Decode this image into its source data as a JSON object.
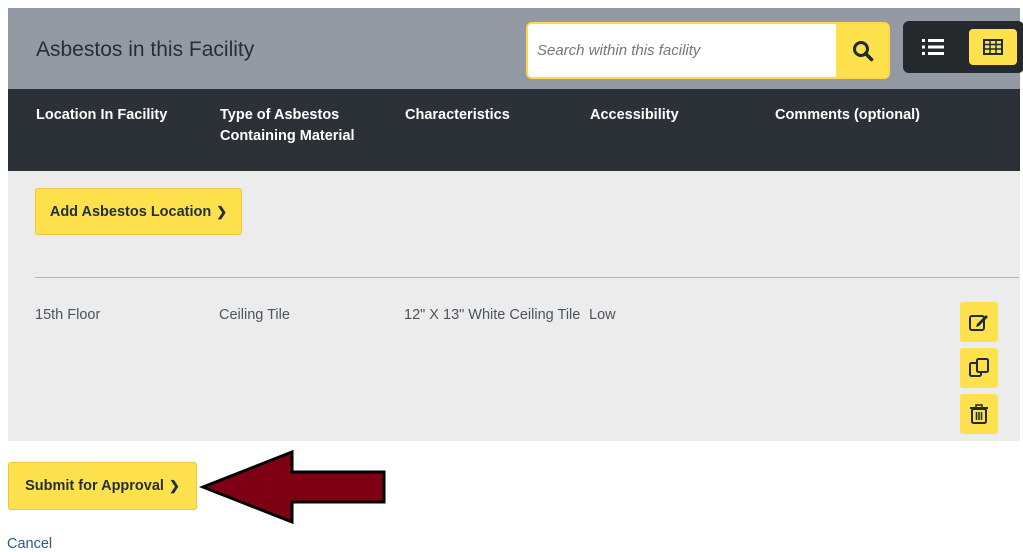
{
  "header": {
    "title": "Asbestos in this Facility",
    "search_placeholder": "Search within this facility",
    "search_icon": "search-icon",
    "view_list_icon": "list-view-icon",
    "view_grid_icon": "grid-view-icon"
  },
  "table": {
    "columns": [
      "Location In Facility",
      "Type of Asbestos Containing Material",
      "Characteristics",
      "Accessibility",
      "Comments (optional)"
    ],
    "rows": [
      {
        "location": "15th Floor",
        "type": "Ceiling Tile",
        "characteristics": "12\" X 13\" White Ceiling Tile",
        "accessibility": "Low",
        "comments": ""
      }
    ],
    "row_actions": [
      "edit-icon",
      "copy-icon",
      "delete-icon"
    ]
  },
  "actions": {
    "add_location_label": "Add Asbestos Location",
    "submit_label": "Submit for Approval",
    "cancel_label": "Cancel",
    "chevron_glyph": "❯"
  },
  "colors": {
    "accent_yellow": "#ffe04d",
    "header_gray": "#939aa3",
    "table_header": "#2b3137",
    "arrow_red": "#7d0014"
  }
}
